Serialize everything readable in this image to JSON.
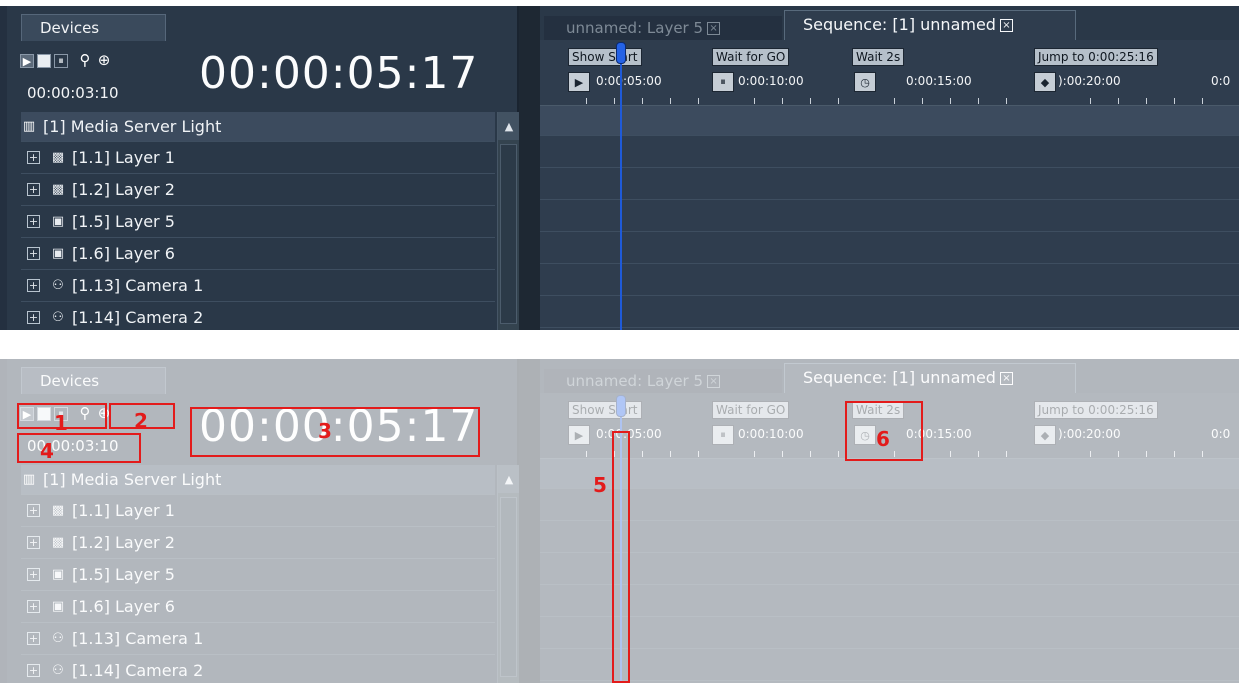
{
  "panels": {
    "devices_tab": "Devices",
    "transport": {
      "play_icon": "play-icon",
      "stop_icon": "stop-icon",
      "pause_icon": "pause-icon",
      "zoom_out_icon": "zoom-out-icon",
      "zoom_in_icon": "zoom-in-icon"
    },
    "timecode_main": "00:00:05:17",
    "timecode_small": "00:00:03:10",
    "tree": {
      "root": "[1] Media Server Light",
      "items": [
        {
          "label": "[1.1] Layer 1",
          "icon": "layer-pattern-icon"
        },
        {
          "label": "[1.2] Layer 2",
          "icon": "layer-pattern-icon"
        },
        {
          "label": "[1.5] Layer 5",
          "icon": "layer-image-icon"
        },
        {
          "label": "[1.6] Layer 6",
          "icon": "layer-image-icon"
        },
        {
          "label": "[1.13] Camera 1",
          "icon": "camera-icon"
        },
        {
          "label": "[1.14] Camera 2",
          "icon": "camera-icon"
        }
      ]
    },
    "tabs": {
      "inactive": "unnamed: Layer 5",
      "active": "Sequence: [1] unnamed"
    },
    "timeline": {
      "markers": [
        {
          "label": "Show Start",
          "icon": "play-icon"
        },
        {
          "label": "Wait for GO",
          "icon": "pause-icon"
        },
        {
          "label": "Wait 2s",
          "icon": "clock-icon"
        },
        {
          "label": "Jump to 0:00:25:16",
          "icon": "jump-icon"
        }
      ],
      "time_labels": [
        "0:00:05:00",
        "0:00:10:00",
        "0:00:15:00",
        "):00:20:00",
        "0:0"
      ]
    }
  },
  "annotations": {
    "callouts": [
      "1",
      "2",
      "3",
      "4",
      "5",
      "6"
    ],
    "color": "#e31b1b"
  },
  "colors": {
    "panel": "#2a3848",
    "timeline": "#2f3d4e",
    "playhead": "#2462e6"
  }
}
